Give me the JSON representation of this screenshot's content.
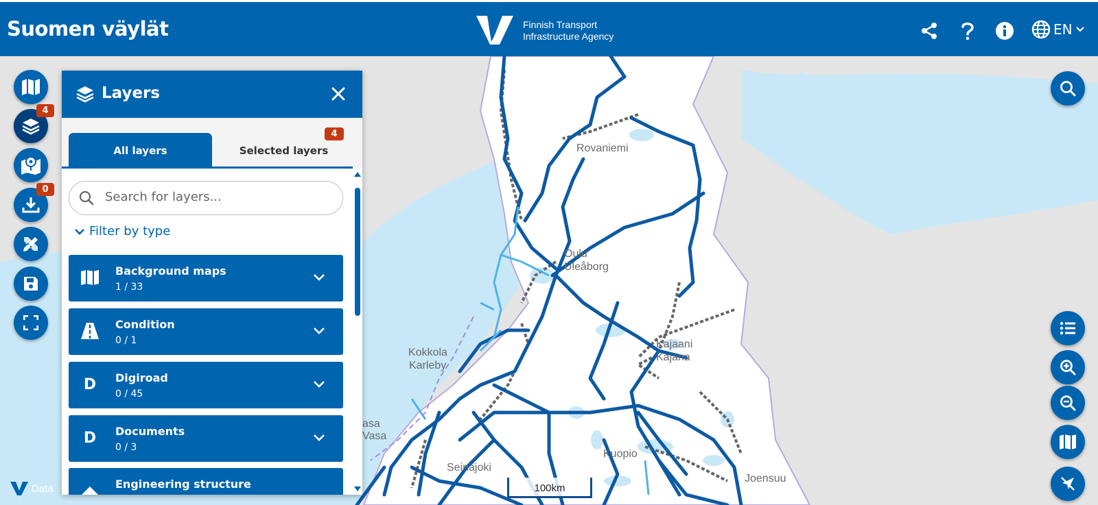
{
  "header": {
    "title": "Suomen väylät",
    "agency_line1": "Finnish Transport",
    "agency_line2": "Infrastructure Agency",
    "language": "EN",
    "icons": [
      "share-icon",
      "help-icon",
      "info-icon",
      "globe-icon"
    ]
  },
  "rail": {
    "layers_badge": "4",
    "downloads_badge": "0",
    "icons": [
      "map-icon",
      "layers-icon",
      "map-marker-icon",
      "download-icon",
      "draw-tools-icon",
      "save-icon",
      "fullscreen-icon"
    ]
  },
  "panel": {
    "title": "Layers",
    "tabs": {
      "all": "All layers",
      "selected": "Selected layers",
      "selected_badge": "4"
    },
    "search_placeholder": "Search for layers...",
    "filter_label": "Filter by type",
    "categories": [
      {
        "name": "Background maps",
        "count": "1 / 33",
        "icon": "map-icon"
      },
      {
        "name": "Condition",
        "count": "0 / 1",
        "icon": "road-icon"
      },
      {
        "name": "Digiroad",
        "count": "0 / 45",
        "icon": "D"
      },
      {
        "name": "Documents",
        "count": "0 / 3",
        "icon": "D"
      },
      {
        "name": "Engineering structure",
        "count": "",
        "icon": "structure-icon"
      }
    ]
  },
  "map": {
    "places": [
      "Rovaniemi",
      "Oulu",
      "Uleåborg",
      "Kokkola",
      "Karleby",
      "Kajaani",
      "Kajana",
      "Kuopio",
      "Seinäjoki",
      "Joensuu",
      "asa",
      "Vasa"
    ],
    "scale": "100km",
    "watermark": "Data"
  },
  "colors": {
    "primary": "#0064AF",
    "badge": "#C53A12",
    "road": "#0d5aa3",
    "water": "#c9e8f7"
  }
}
